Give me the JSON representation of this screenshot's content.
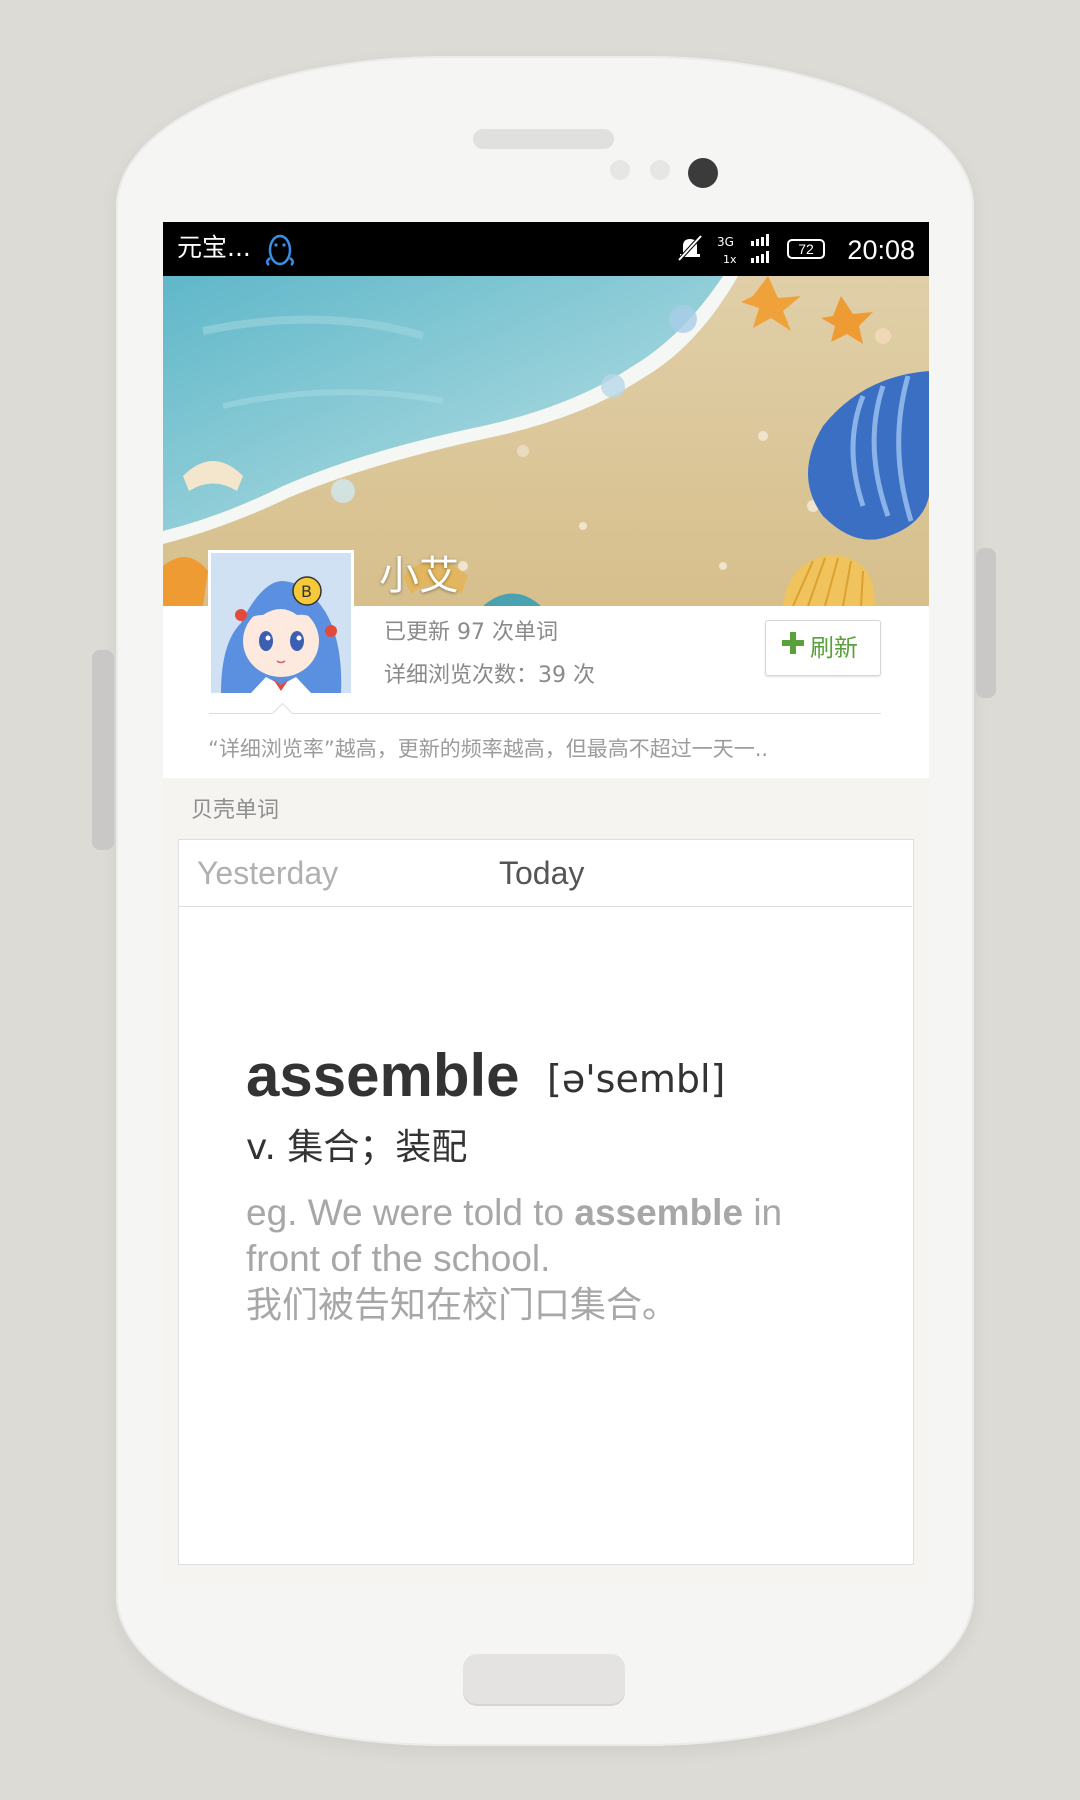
{
  "status_bar": {
    "carrier_text": "元宝...",
    "signal_text": "3G",
    "signal_sub": "1x",
    "battery": "72",
    "time": "20:08"
  },
  "profile": {
    "username": "小艾",
    "updated_count_text": "已更新 97 次单词",
    "views_text": "详细浏览次数：39 次",
    "refresh_label": "刷新",
    "hint": "“详细浏览率”越高，更新的频率越高，但最高不超过一天一.."
  },
  "section": {
    "label": "贝壳单词"
  },
  "tabs": [
    {
      "label": "Yesterday",
      "active": false
    },
    {
      "label": "Today",
      "active": true
    }
  ],
  "word_card": {
    "word": "assemble",
    "phonetic": "[ə'sembl]",
    "definition": "v.  集合；装配",
    "example_prefix": "eg. We were told to ",
    "example_word": "assemble",
    "example_suffix": " in front of the school.",
    "example_cn": "我们被告知在校门口集合。"
  },
  "colors": {
    "accent_green": "#5aa03b",
    "text_dark": "#333333",
    "text_muted": "#a7a7a7"
  },
  "icons": [
    "qq-penguin-icon",
    "mute-bell-icon",
    "signal-icon",
    "battery-icon",
    "plus-icon"
  ]
}
